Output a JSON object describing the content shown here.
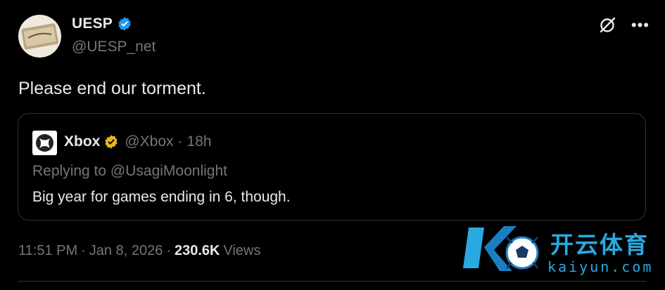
{
  "tweet": {
    "author": {
      "display_name": "UESP",
      "handle": "@UESP_net",
      "verified": true
    },
    "text": "Please end our torment.",
    "meta": {
      "time": "11:51 PM",
      "date": "Jan 8, 2026",
      "separator": "·",
      "views_count": "230.6K",
      "views_label": "Views"
    }
  },
  "quote": {
    "author": {
      "display_name": "Xbox",
      "handle": "@Xbox",
      "verified": true
    },
    "separator": "·",
    "time": "18h",
    "replying_prefix": "Replying to",
    "replying_to": "@UsagiMoonlight",
    "text": "Big year for games ending in 6, though."
  },
  "icons": {
    "more": "more-icon",
    "grok": "grok-icon",
    "verified_blue": "verified-badge-icon",
    "verified_gold": "verified-gold-badge-icon"
  },
  "watermark": {
    "cn_text": "开云体育",
    "en_text": "kaiyun.com"
  },
  "colors": {
    "background": "#000000",
    "text": "#e7e9ea",
    "muted": "#71767b",
    "border": "#2f3336",
    "verified_blue": "#1d9bf0",
    "verified_gold": "#e2b719",
    "watermark": "#29a9e0"
  }
}
